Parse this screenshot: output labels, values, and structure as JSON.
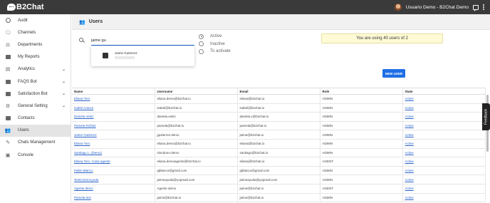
{
  "header": {
    "logo_text": "B2Chat",
    "user_name": "Usuario Demo - B2Chat Demo"
  },
  "sidebar": {
    "items": [
      {
        "label": "Audit",
        "icon": "check-circle-icon",
        "expandable": false
      },
      {
        "label": "Channels",
        "icon": "chat-bubbles-icon",
        "expandable": false
      },
      {
        "label": "Departments",
        "icon": "tree-icon",
        "expandable": false
      },
      {
        "label": "My Reports",
        "icon": "report-icon",
        "expandable": false
      },
      {
        "label": "Analytics",
        "icon": "bar-chart-icon",
        "expandable": true
      },
      {
        "label": "FAQS Bot",
        "icon": "faq-bot-icon",
        "expandable": true
      },
      {
        "label": "Satisfaction Bot",
        "icon": "satisfaction-bot-icon",
        "expandable": true
      },
      {
        "label": "General Setting",
        "icon": "gear-icon",
        "expandable": true
      },
      {
        "label": "Contacts",
        "icon": "contacts-icon",
        "expandable": false
      },
      {
        "label": "Users",
        "icon": "users-icon",
        "expandable": false,
        "active": true
      },
      {
        "label": "Chats Management",
        "icon": "chats-management-icon",
        "expandable": false
      },
      {
        "label": "Console",
        "icon": "console-icon",
        "expandable": false
      }
    ]
  },
  "page": {
    "title": "Users"
  },
  "search": {
    "value": "jaime gu",
    "suggestion_name": "Jaime Gutierrez"
  },
  "status_filter": {
    "options": [
      "Active",
      "Inactive",
      "To activate"
    ],
    "selected": "Active"
  },
  "usage_text": "You are using 40 users of 2",
  "new_user_label": "NEW USER",
  "table": {
    "columns": [
      "Name",
      "Username",
      "Email",
      "Role",
      "State"
    ],
    "rows": [
      [
        "Eliana Toro",
        "eliana.demo@b2chat.io",
        "eliana@b2chat.io",
        "ADMIN",
        "Active"
      ],
      [
        "Isabel Aranzo",
        "isabel@b2chat.io",
        "isabel@b2chat.io",
        "ADMIN",
        "Active"
      ],
      [
        "Daniela Velez",
        "daniela.velez",
        "daniela.v@b2chat.io",
        "ADMIN",
        "Active"
      ],
      [
        "Pamela Richter",
        "pamela@b2chat.io",
        "pamela@b2chat.io",
        "ADMIN",
        "Active"
      ],
      [
        "Jaime Gutierrez",
        "jgutierrez.demo",
        "jaime@b2chat.io",
        "ADMIN",
        "Active"
      ],
      [
        "Eliana Toro",
        "eliana.demo@b2chat.io",
        "eliana@b2chat.io",
        "ADMIN",
        "Active"
      ],
      [
        "Santiago L. (Demo)",
        "slondono-demo",
        "santiago@b2chat.io",
        "ADMIN",
        "Active"
      ],
      [
        "Eliana Toro -Casa agente",
        "eliana.demoagente@b2chat.io",
        "eliana@b2chat.io",
        "AGENT",
        "Active"
      ],
      [
        "Pablo Blanco",
        "pjblanco@gmail.com",
        "pjblanco@gmail.com",
        "ADMIN",
        "Active"
      ],
      [
        "TestCentroAyuda",
        "jaimeayuda@yopmail.com",
        "jaimeayuda@yopmail.com",
        "ADMIN",
        "Active"
      ],
      [
        "Agente demo",
        "Agente demo",
        "jaime@b2chat.io",
        "AGENT",
        "Active"
      ],
      [
        "Pamela test",
        "jaime@b2chat.io",
        "jaime@b2chat.io",
        "ADMIN",
        "Active"
      ]
    ]
  },
  "feedback_label": "Feedback"
}
